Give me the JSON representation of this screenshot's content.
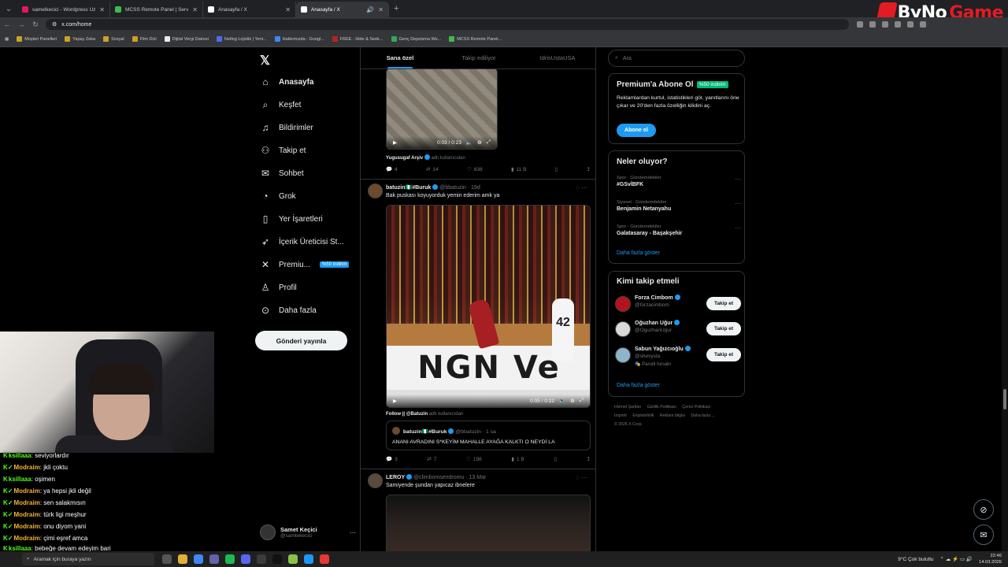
{
  "browser": {
    "tabs": [
      {
        "title": "samelkecici - Wordpress Uzman...",
        "color": "#e21a5d"
      },
      {
        "title": "MCSS Remote Panel | Servers",
        "color": "#3fb950"
      },
      {
        "title": "Anasayfa / X",
        "color": "#ffffff"
      },
      {
        "title": "Anasayfa / X",
        "color": "#ffffff"
      }
    ],
    "url": "x.com/home",
    "bookmarks": [
      "Müşteri Panelleri",
      "Yapay Zeka",
      "Sosyal",
      "Film Dizi",
      "Dijital Vergi Dairesi",
      "Netlog Lojistik | Yeni...",
      "Hakkımızda - Googl...",
      "FREE - Hide & Seek...",
      "Genç Depoisma We...",
      "MCSS Remote Panel..."
    ]
  },
  "brand": {
    "part1": "ByNo",
    "part2": "Game"
  },
  "nav": {
    "items": [
      {
        "label": "Anasayfa",
        "icon": "home-icon"
      },
      {
        "label": "Keşfet",
        "icon": "search-icon"
      },
      {
        "label": "Bildirimler",
        "icon": "bell-icon"
      },
      {
        "label": "Takip et",
        "icon": "person-add-icon"
      },
      {
        "label": "Sohbet",
        "icon": "mail-icon"
      },
      {
        "label": "Grok",
        "icon": "grok-icon"
      },
      {
        "label": "Yer İşaretleri",
        "icon": "bookmark-icon"
      },
      {
        "label": "İçerik Üreticisi St...",
        "icon": "rocket-icon"
      },
      {
        "label": "Premiu...",
        "icon": "x-icon"
      },
      {
        "label": "Profil",
        "icon": "profile-icon"
      },
      {
        "label": "Daha fazla",
        "icon": "more-icon"
      }
    ],
    "premium_badge": "%50 indirim",
    "post_button": "Gönderi yayınla",
    "account": {
      "name": "Samet Keçici",
      "handle": "@samtekecici"
    }
  },
  "timeline": {
    "tabs": [
      "Sana özel",
      "Takip ediliyor",
      "IdrisUstaUSA"
    ],
    "post1": {
      "video_time": "0:03 / 0:23",
      "attribution_user": "Yugusugaf Arşiv",
      "attribution_suffix": "adlı kullanıcıdan",
      "replies": "4",
      "reposts": "14",
      "likes": "838",
      "views": "11 B"
    },
    "post2": {
      "name": "batuzin🇳🇬#Buruk",
      "handle": "@bbatuzin · 19d",
      "text": "Bak puskası koyuyorduk yemin ederim amk ya",
      "video_time": "0:05 / 0:22",
      "board_text": "NGN Ve",
      "jersey": "42",
      "follow_line": "Follow || @Batuzin",
      "follow_suffix": "adlı kullanıcıdan",
      "quote_name": "batuzin🇳🇬#Buruk",
      "quote_handle": "@bbatuzin · 1 sa",
      "quote_text": "ANANI AVRADINI S*KEYİM MAHALLE AYAĞA KALKTI O NEYDİ LA",
      "replies": "3",
      "reposts": "7",
      "likes": "196",
      "views": "1 B"
    },
    "post3": {
      "name": "LEROY",
      "handle": "@climbomsendromu · 13 Mar",
      "text": "Samiyende şundan yapıcaz ibnelere"
    }
  },
  "sidebar": {
    "search_placeholder": "Ara",
    "premium": {
      "title": "Premium'a Abone Ol",
      "badge": "%50 indirim",
      "desc": "Reklamlardan kurtul, istatistikleri gör, yanıtlarını öne çıkar ve 20'den fazla özelliğin kilidini aç.",
      "button": "Abone ol"
    },
    "trends_title": "Neler oluyor?",
    "trends": [
      {
        "category": "Spor · Gündemdekiler",
        "name": "#GSvİBFK"
      },
      {
        "category": "Siyaset · Gündemdekiler",
        "name": "Benjamin Netanyahu"
      },
      {
        "category": "Spor · Gündemdekiler",
        "name": "Galatasaray - Başakşehir"
      }
    ],
    "show_more": "Daha fazla göster",
    "follow_title": "Kimi takip etmeli",
    "follow": [
      {
        "name": "Forza Cimbom",
        "handle": "@forzacimbom",
        "note": "",
        "color": "#b5121b"
      },
      {
        "name": "Oğuzhan Uğur",
        "handle": "@OguzhanUgur",
        "note": "",
        "color": "#d9d9d9"
      },
      {
        "name": "Sabun Yağızcıoğlu",
        "handle": "@shevysta",
        "note": "🎭 Parodi hesabı",
        "color": "#8fb3c9"
      }
    ],
    "follow_button": "Takip et",
    "follow_more": "Daha fazla göster",
    "footer": [
      "Hizmet Şartları",
      "Gizlilik Politikası",
      "Çerez Politikası",
      "Imprint",
      "Erişilebilirlik",
      "Reklam bilgisi",
      "Daha fazla ...",
      "© 2026 X Corp."
    ]
  },
  "webcam": {
    "label": "streamer webcam"
  },
  "chat": [
    {
      "user": "ksillaaa",
      "msg": "seviyorlardır",
      "color": "#53fc18"
    },
    {
      "user": "Modraim",
      "msg": "jkli çoktu",
      "color": "#f2b233"
    },
    {
      "user": "ksillaaa",
      "msg": "oşimen",
      "color": "#53fc18"
    },
    {
      "user": "Modraim",
      "msg": "ya hepsi jkli değil",
      "color": "#f2b233"
    },
    {
      "user": "Modraim",
      "msg": "sen salakmısın",
      "color": "#f2b233"
    },
    {
      "user": "Modraim",
      "msg": "türk ligi meşhur",
      "color": "#f2b233"
    },
    {
      "user": "Modraim",
      "msg": "onu diyom yani",
      "color": "#f2b233"
    },
    {
      "user": "Modraim",
      "msg": "çimi eşref amca",
      "color": "#f2b233"
    },
    {
      "user": "ksillaaa",
      "msg": "bebeğe devam edeyim bari",
      "color": "#53fc18"
    }
  ],
  "taskbar": {
    "search": "Aramak için buraya yazın",
    "weather": "9°C  Çok bulutlu",
    "time": "22:46",
    "date": "14.03.2026"
  }
}
